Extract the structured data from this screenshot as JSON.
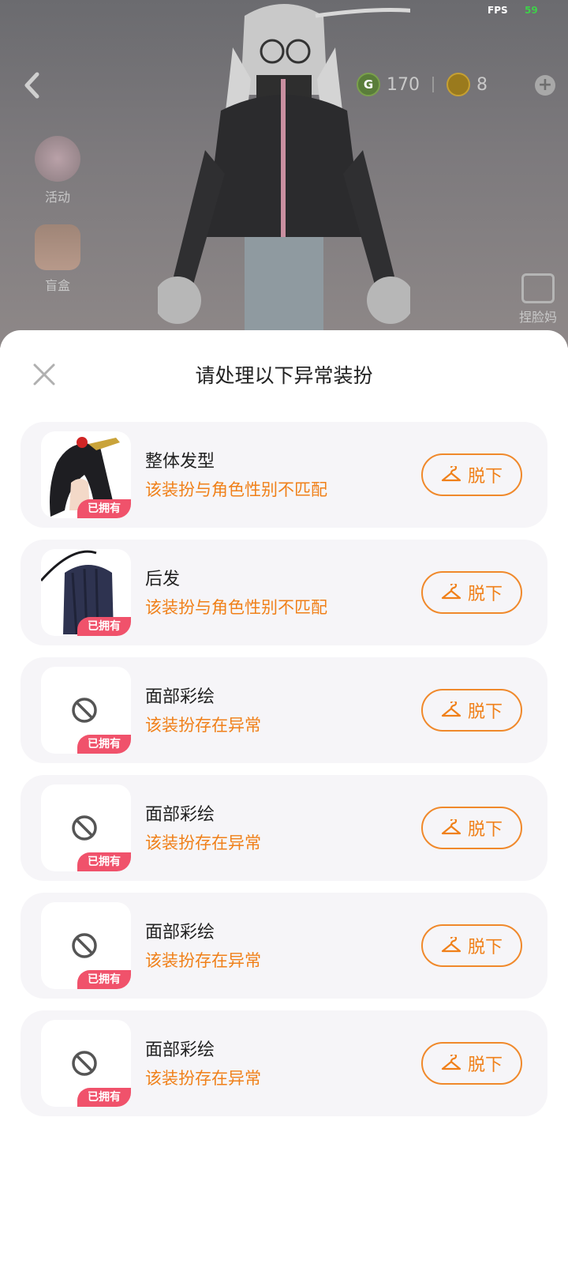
{
  "status": {
    "fps_label": "FPS",
    "fps_value": "59"
  },
  "top_bar": {
    "g_coin_icon": "G",
    "g_coins": "170",
    "c_coins": "8"
  },
  "side_menu": {
    "activity_label": "活动",
    "blindbox_label": "盲盒"
  },
  "face_button_label": "捏脸妈",
  "sheet": {
    "title": "请处理以下异常装扮"
  },
  "items": [
    {
      "name": "整体发型",
      "warning": "该装扮与角色性别不匹配",
      "badge": "已拥有",
      "button": "脱下",
      "thumb": "hairstyle"
    },
    {
      "name": "后发",
      "warning": "该装扮与角色性别不匹配",
      "badge": "已拥有",
      "button": "脱下",
      "thumb": "back-hair"
    },
    {
      "name": "面部彩绘",
      "warning": "该装扮存在异常",
      "badge": "已拥有",
      "button": "脱下",
      "thumb": "none"
    },
    {
      "name": "面部彩绘",
      "warning": "该装扮存在异常",
      "badge": "已拥有",
      "button": "脱下",
      "thumb": "none"
    },
    {
      "name": "面部彩绘",
      "warning": "该装扮存在异常",
      "badge": "已拥有",
      "button": "脱下",
      "thumb": "none"
    },
    {
      "name": "面部彩绘",
      "warning": "该装扮存在异常",
      "badge": "已拥有",
      "button": "脱下",
      "thumb": "none"
    }
  ],
  "colors": {
    "accent": "#f08019",
    "badge": "#f0526b",
    "card_bg": "#f6f5f8"
  }
}
